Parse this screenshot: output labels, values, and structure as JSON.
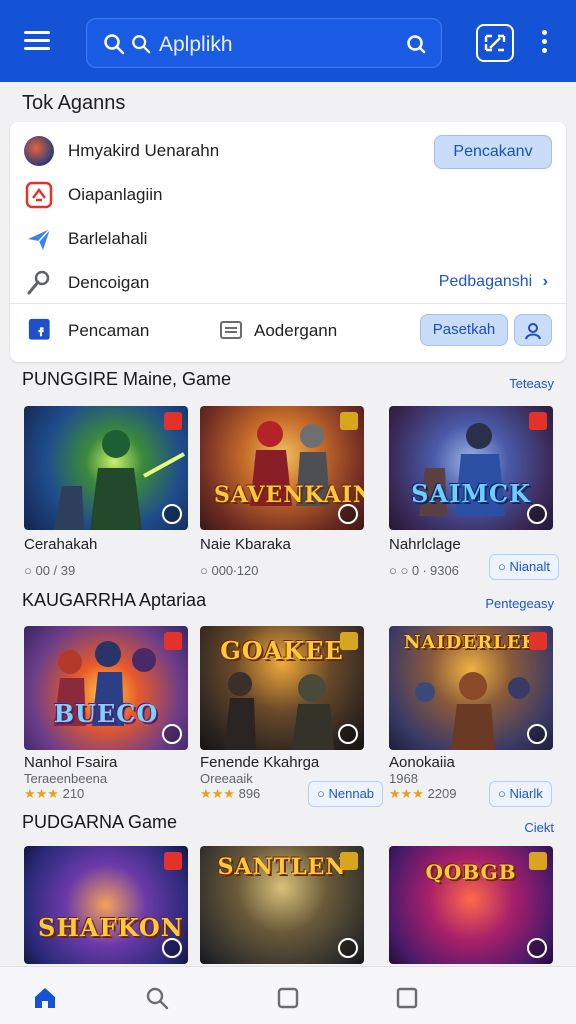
{
  "header": {
    "search_text": "Aplplikh",
    "icons": [
      "menu-icon",
      "search-icon",
      "voice-search-icon",
      "qr-scan-icon",
      "more-vert-icon"
    ],
    "accent": "#1553d6"
  },
  "page_title": "Tok Aganns",
  "quick_card": {
    "rows": [
      {
        "label": "Hmyakird Uenarahn",
        "icon": "avatar-icon"
      },
      {
        "label": "Oiapanlagiin",
        "icon": "app-icon"
      },
      {
        "label": "Barlelahali",
        "icon": "send-icon"
      },
      {
        "label": "Dencoigan",
        "icon": "wrench-icon"
      }
    ],
    "primary_button": "Pencakanv",
    "row4_link": "Pedbaganshi",
    "bottom_left": "Pencaman",
    "bottom_mid": "Aodergann",
    "bottom_button": "Pasetkah"
  },
  "sections": [
    {
      "title": "PUNGGIRE Maine, Game",
      "more": "Teteasy",
      "games": [
        {
          "name": "Cerahakah",
          "meta": "○ 00 / 39",
          "logo": ""
        },
        {
          "name": "Naie Kbaraka",
          "meta": "○ 000∙120",
          "logo": "SAVENKAIN"
        },
        {
          "name": "Nahrlclage",
          "meta": "○ ○ 0 ∙ 9306",
          "logo": "SAIMCK",
          "button": "Nianalt"
        }
      ]
    },
    {
      "title": "KAUGARRHA Aptariaa",
      "more": "Pentegeasy",
      "games": [
        {
          "name": "Nanhol Fsaira",
          "meta": "Teraeenbeena",
          "rating_stars": "★★★",
          "rating": "210",
          "logo": "BUECO"
        },
        {
          "name": "Fenende Kkahrga",
          "meta": "Oreeaaik",
          "rating_stars": "★★★",
          "rating": "896",
          "button": "Nennab",
          "logo": "GOAKEE"
        },
        {
          "name": "Aonokaiia",
          "meta": "1968",
          "rating_stars": "★★★",
          "rating": "2209",
          "button": "Niarlk",
          "logo": "NAIDERLEK"
        }
      ]
    },
    {
      "title": "PUDGARNA Game",
      "more": "Ciekt",
      "games": [
        {
          "logo": "SHAFKON"
        },
        {
          "logo": "SANTLEN"
        },
        {
          "logo": "QOBGB"
        }
      ]
    }
  ],
  "bottom_nav": [
    {
      "icon": "home-icon",
      "active": true
    },
    {
      "icon": "search-icon",
      "active": false
    },
    {
      "icon": "square-icon",
      "active": false
    },
    {
      "icon": "square-icon",
      "active": false
    }
  ]
}
